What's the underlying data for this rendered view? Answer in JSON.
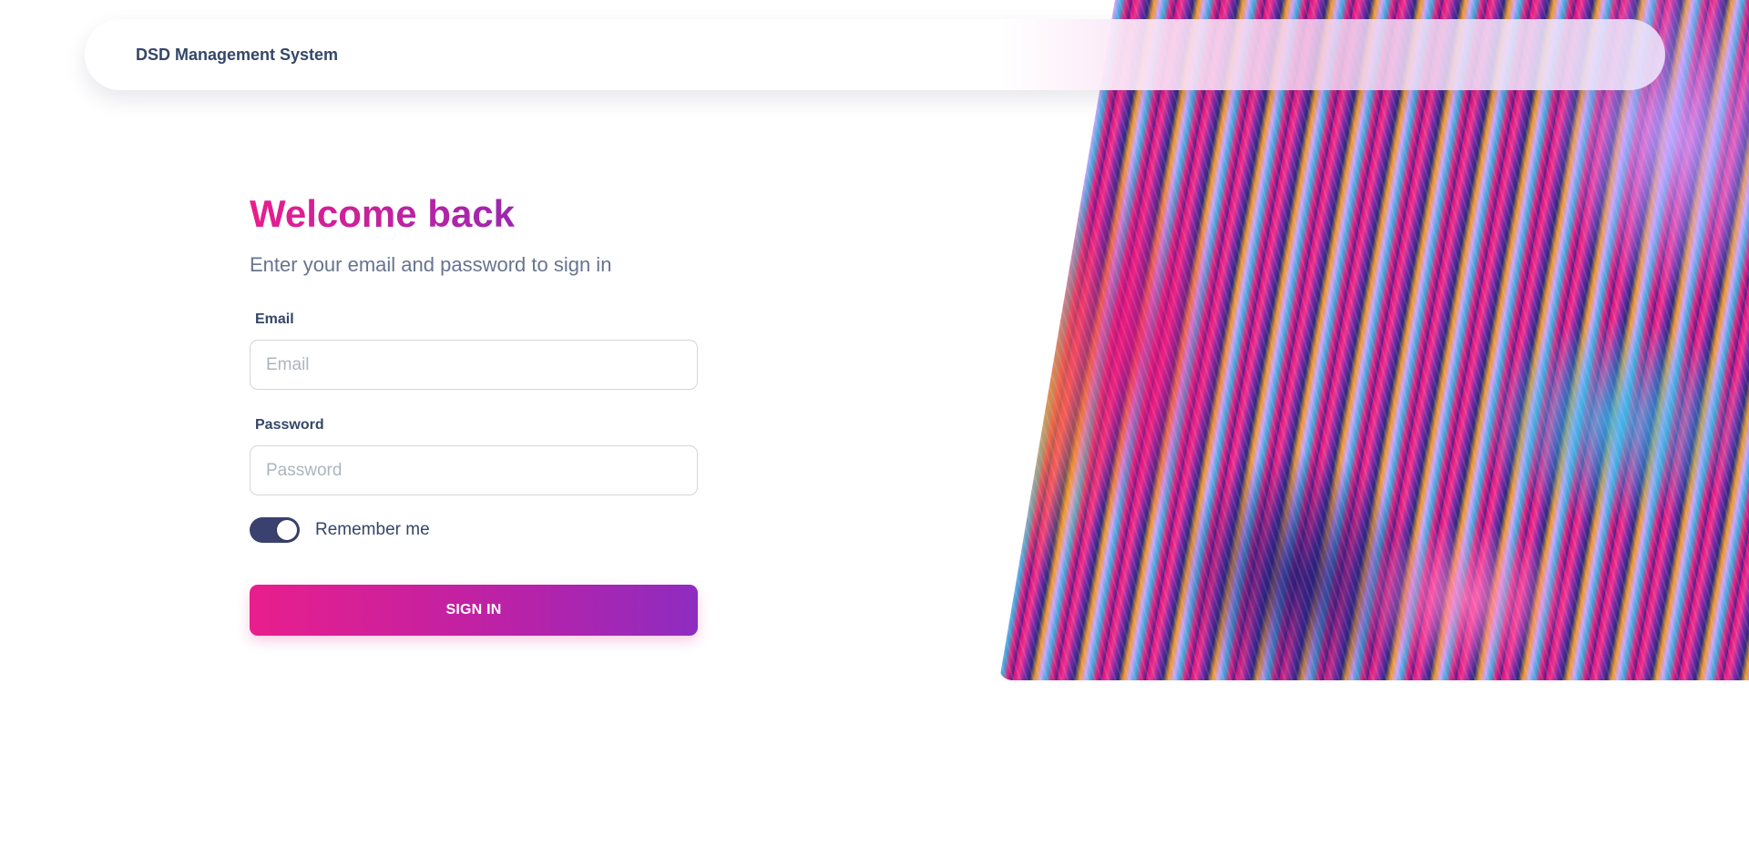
{
  "navbar": {
    "brand": "DSD Management System"
  },
  "signin": {
    "title": "Welcome back",
    "subtitle": "Enter your email and password to sign in",
    "email_label": "Email",
    "email_placeholder": "Email",
    "email_value": "",
    "password_label": "Password",
    "password_placeholder": "Password",
    "password_value": "",
    "remember_label": "Remember me",
    "remember_checked": true,
    "submit_label": "SIGN IN"
  },
  "colors": {
    "accent_start": "#e91e8c",
    "accent_end": "#9c27b0",
    "text_dark": "#344767",
    "text_muted": "#67748e",
    "toggle_on": "#3a416f"
  }
}
